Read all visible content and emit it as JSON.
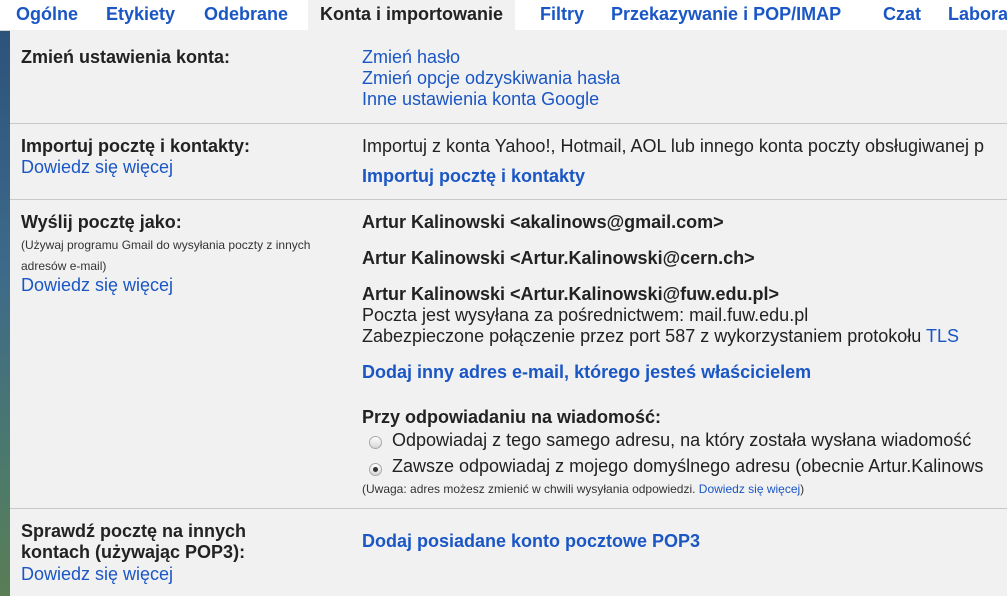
{
  "tabs": [
    {
      "label": "Ogólne"
    },
    {
      "label": "Etykiety"
    },
    {
      "label": "Odebrane"
    },
    {
      "label": "Konta i importowanie"
    },
    {
      "label": "Filtry"
    },
    {
      "label": "Przekazywanie i POP/IMAP"
    },
    {
      "label": "Czat"
    },
    {
      "label": "Labora"
    }
  ],
  "account": {
    "label": "Zmień ustawienia konta:",
    "links": [
      "Zmień hasło",
      "Zmień opcje odzyskiwania hasła",
      "Inne ustawienia konta Google"
    ]
  },
  "import": {
    "label": "Importuj pocztę i kontakty:",
    "learn_more": "Dowiedz się więcej",
    "description": "Importuj z konta Yahoo!, Hotmail, AOL lub innego konta poczty obsługiwanej p",
    "action": "Importuj pocztę i kontakty"
  },
  "send_as": {
    "label": "Wyślij pocztę jako:",
    "note_line1": "(Używaj programu Gmail do wysyłania poczty z innych",
    "note_line2": "adresów e-mail)",
    "learn_more": "Dowiedz się więcej",
    "addresses": [
      "Artur Kalinowski <akalinows@gmail.com>",
      "Artur Kalinowski <Artur.Kalinowski@cern.ch>",
      "Artur Kalinowski <Artur.Kalinowski@fuw.edu.pl>"
    ],
    "smtp_line": "Poczta jest wysyłana za pośrednictwem: mail.fuw.edu.pl",
    "secure_line": "Zabezpieczone połączenie przez port 587 z wykorzystaniem protokołu",
    "tls": "TLS",
    "add_address": "Dodaj inny adres e-mail, którego jesteś właścicielem",
    "reply_heading": "Przy odpowiadaniu na wiadomość:",
    "reply_options": [
      {
        "label": "Odpowiadaj z tego samego adresu, na który została wysłana wiadomość",
        "selected": false
      },
      {
        "label": "Zawsze odpowiadaj z mojego domyślnego adresu (obecnie Artur.Kalinows",
        "selected": true
      }
    ],
    "note_prefix": "(Uwaga: adres możesz zmienić w chwili wysyłania odpowiedzi. ",
    "note_link": "Dowiedz się więcej",
    "note_suffix": ")"
  },
  "pop3": {
    "label_line1": "Sprawdź pocztę na innych",
    "label_line2": "kontach (używając POP3):",
    "learn_more": "Dowiedz się więcej",
    "action": "Dodaj posiadane konto pocztowe POP3"
  },
  "colors": {
    "link": "#1a56c4",
    "panel": "#f1f1f1",
    "tabbar": "#ffffff"
  }
}
